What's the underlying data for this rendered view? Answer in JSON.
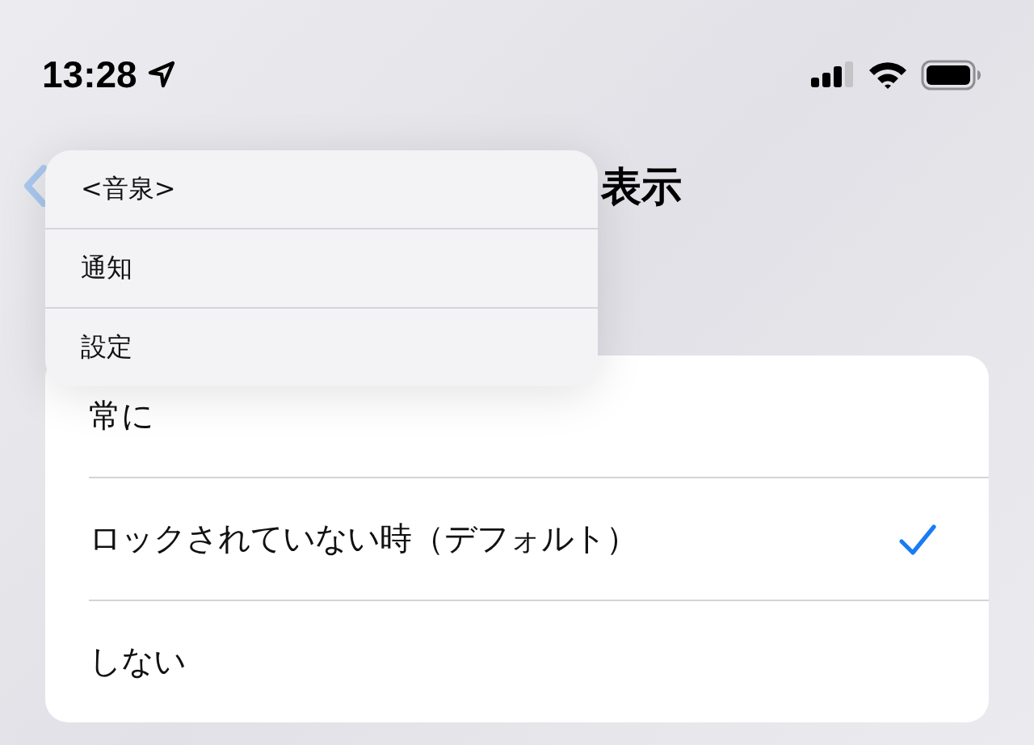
{
  "status_bar": {
    "time": "13:28"
  },
  "nav": {
    "title": "表示"
  },
  "options": [
    {
      "label": "常に",
      "selected": false
    },
    {
      "label": "ロックされていない時（デフォルト）",
      "selected": true
    },
    {
      "label": "しない",
      "selected": false
    }
  ],
  "menu": {
    "items": [
      {
        "label": "<音泉>"
      },
      {
        "label": "通知"
      },
      {
        "label": "設定"
      }
    ]
  }
}
